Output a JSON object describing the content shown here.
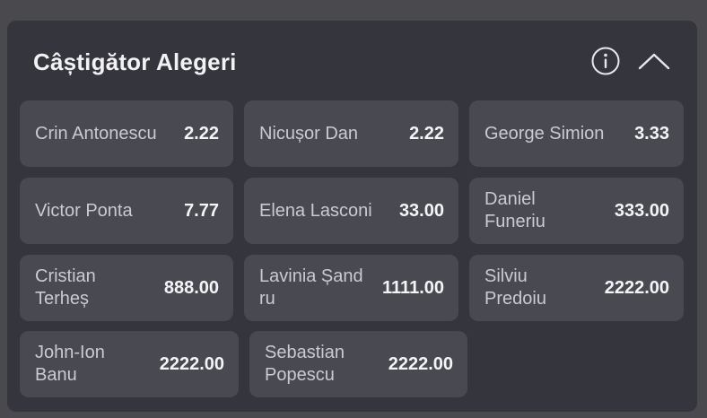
{
  "market": {
    "title": "Câștigător Alegeri",
    "info_icon": "info-icon",
    "collapse_icon": "chevron-up-icon"
  },
  "rows": [
    [
      {
        "name": "Crin Antonescu",
        "odds": "2.22"
      },
      {
        "name": "Nicușor Dan",
        "odds": "2.22"
      },
      {
        "name": "George Simion",
        "odds": "3.33"
      }
    ],
    [
      {
        "name": "Victor Ponta",
        "odds": "7.77"
      },
      {
        "name": "Elena Lasconi",
        "odds": "33.00"
      },
      {
        "name": "Daniel Funeriu",
        "odds": "333.00"
      }
    ],
    [
      {
        "name": "Cristian Terheș",
        "odds": "888.00"
      },
      {
        "name": "Lavinia Șandru",
        "odds": "1111.00"
      },
      {
        "name": "Silviu Predoiu",
        "odds": "2222.00"
      }
    ],
    [
      {
        "name": "John-Ion Banu",
        "odds": "2222.00"
      },
      {
        "name": "Sebastian Popescu",
        "odds": "2222.00"
      }
    ]
  ]
}
